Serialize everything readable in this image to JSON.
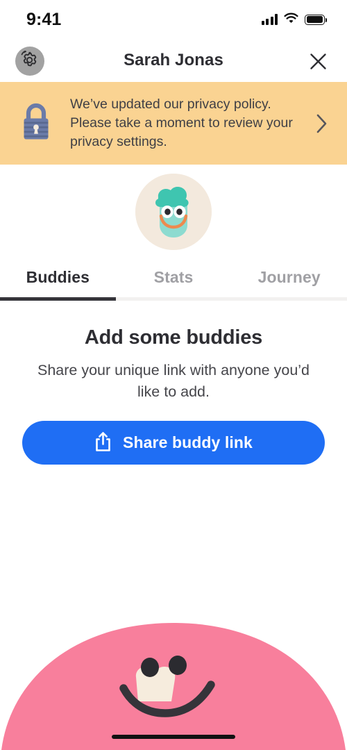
{
  "status_bar": {
    "time": "9:41",
    "signal_icon": "cellular-signal-icon",
    "wifi_icon": "wifi-icon",
    "battery_icon": "battery-full-icon"
  },
  "nav_bar": {
    "title": "Sarah Jonas",
    "settings_icon": "gear-icon",
    "close_icon": "close-icon"
  },
  "banner": {
    "lock_icon": "lock-icon",
    "message": "We’ve updated our privacy policy. Please take a moment to review your privacy settings.",
    "chevron_icon": "chevron-right-icon",
    "background_color": "#fad392"
  },
  "hero": {
    "avatar_icon": "user-avatar-monster-icon",
    "avatar_background_color": "#f3e9dd"
  },
  "tabs": [
    {
      "label": "Buddies",
      "active": true
    },
    {
      "label": "Stats",
      "active": false
    },
    {
      "label": "Journey",
      "active": false
    }
  ],
  "main": {
    "title": "Add some buddies",
    "subtitle": "Share your unique link with anyone you’d like to add.",
    "share_button_label": "Share buddy link",
    "share_button_icon": "share-icon",
    "share_button_color": "#1f6ef4"
  },
  "decoration": {
    "character_icon": "pink-monster-character",
    "character_color": "#f87f9c"
  },
  "home_indicator": "home-indicator"
}
